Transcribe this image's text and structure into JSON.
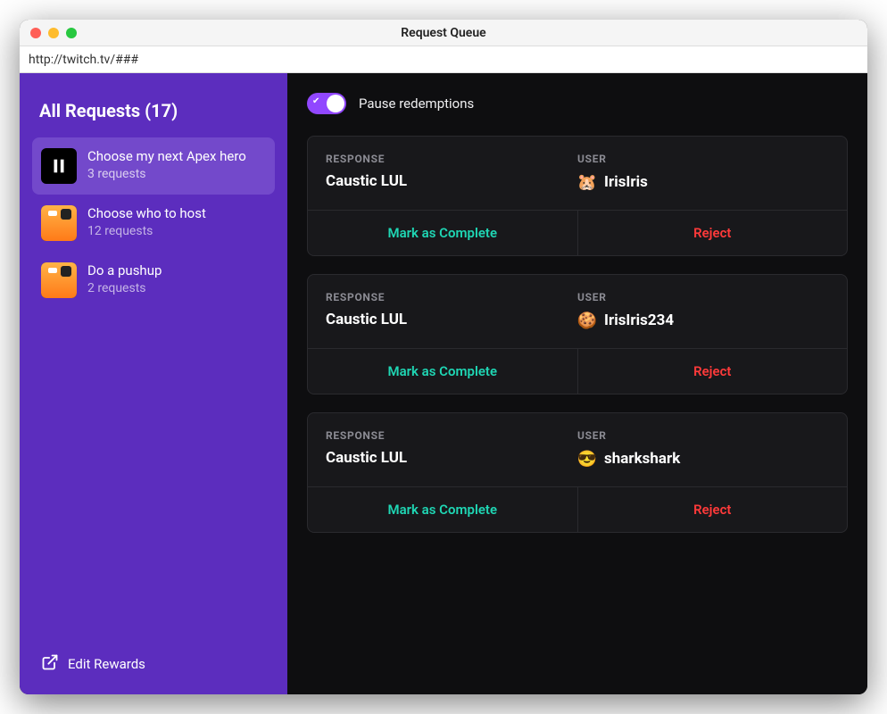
{
  "window": {
    "title": "Request Queue",
    "url": "http://twitch.tv/###"
  },
  "sidebar": {
    "title_prefix": "All Requests",
    "total_count": 17,
    "rewards": [
      {
        "label": "Choose my next Apex hero",
        "count_text": "3 requests",
        "active": true,
        "icon": "pause"
      },
      {
        "label": "Choose who to host",
        "count_text": "12 requests",
        "active": false,
        "icon": "avatar1"
      },
      {
        "label": "Do a pushup",
        "count_text": "2 requests",
        "active": false,
        "icon": "avatar2"
      }
    ],
    "edit_label": "Edit Rewards"
  },
  "main": {
    "pause_label": "Pause redemptions",
    "toggle_on": true,
    "headers": {
      "response": "RESPONSE",
      "user": "USER"
    },
    "actions": {
      "complete": "Mark as Complete",
      "reject": "Reject"
    },
    "requests": [
      {
        "response": "Caustic LUL",
        "user": "IrisIris",
        "emoji": "🐹"
      },
      {
        "response": "Caustic LUL",
        "user": "IrisIris234",
        "emoji": "🍪"
      },
      {
        "response": "Caustic LUL",
        "user": "sharkshark",
        "emoji": "😎"
      }
    ]
  }
}
